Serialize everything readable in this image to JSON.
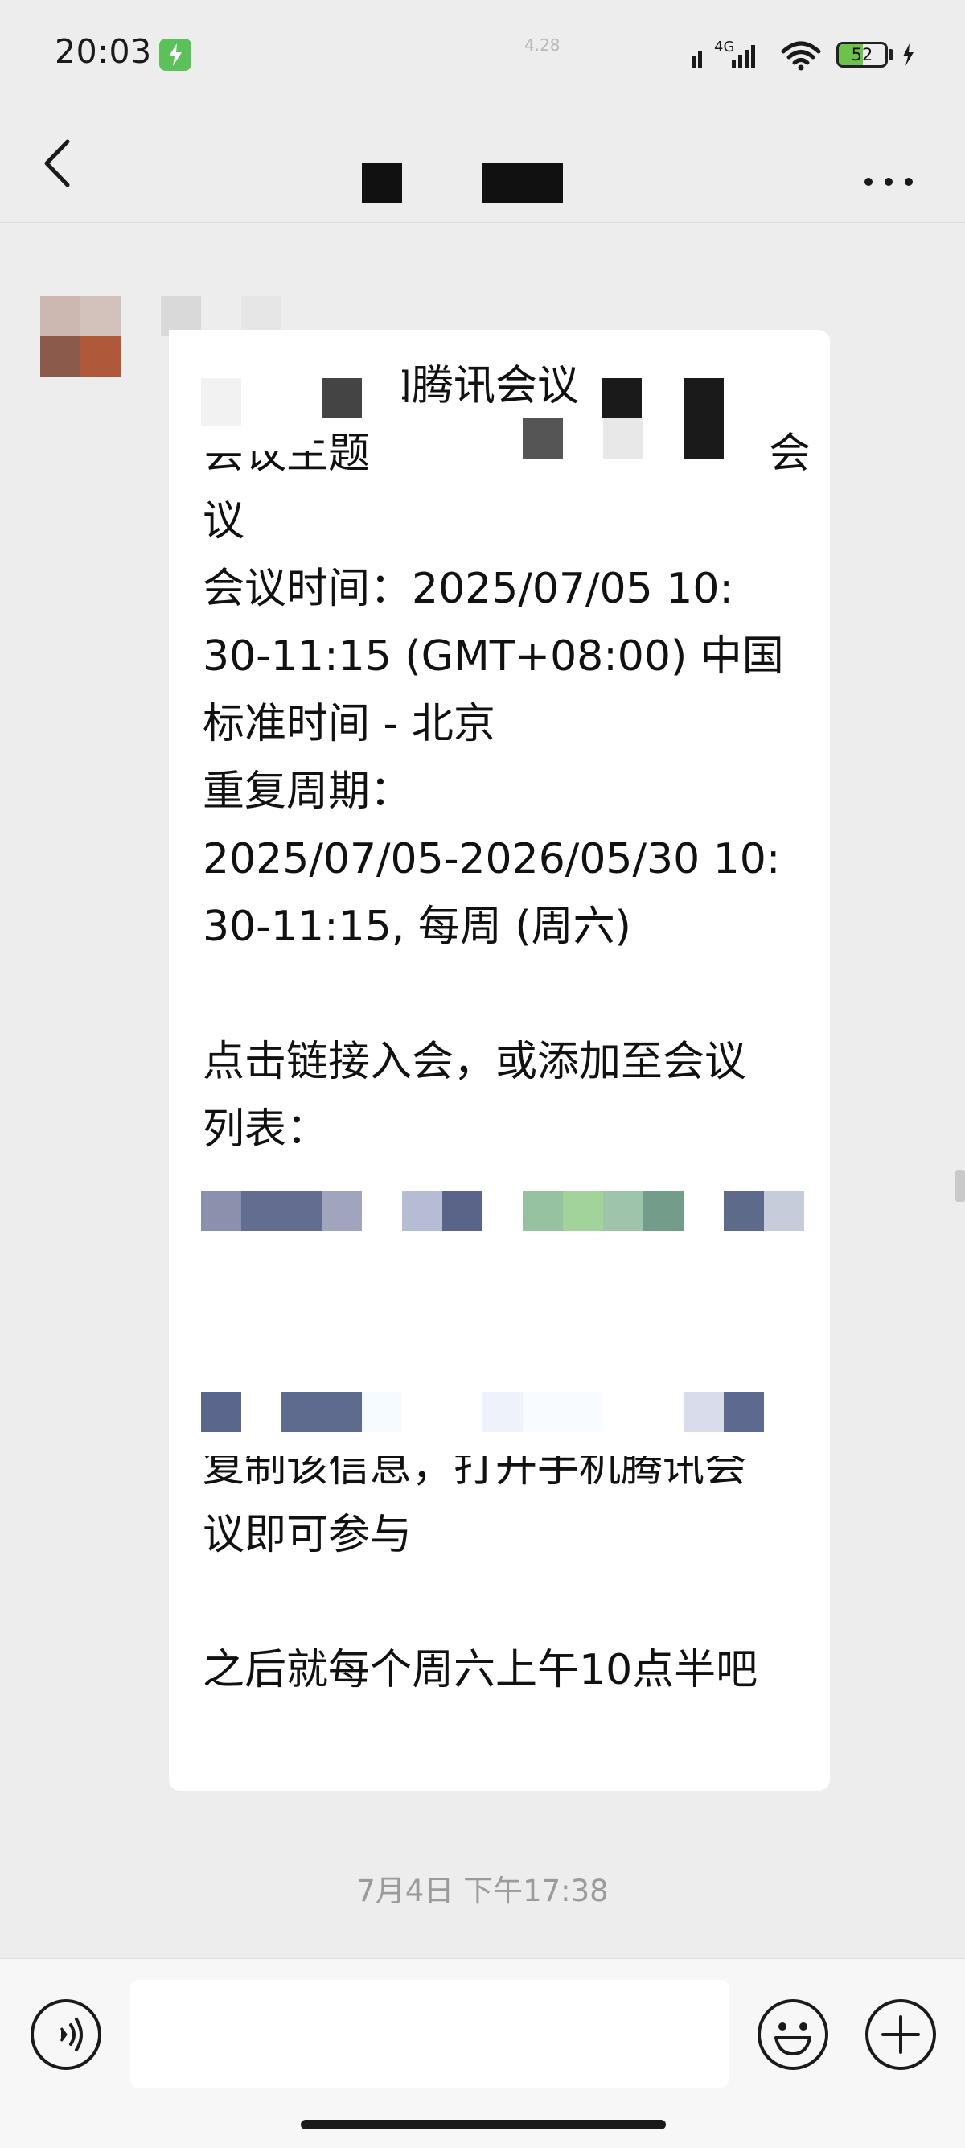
{
  "status_bar": {
    "time": "20:03",
    "net_speed": "4.28",
    "network": "4G",
    "battery_level": "52",
    "battery_fraction": 0.52
  },
  "nav": {
    "back_icon": "chevron-left-icon",
    "more_icon": "more-dots-icon"
  },
  "message": {
    "line_1": "邀请您参加腾讯会议",
    "line_2": "会议主题",
    "line_2_tail": "会",
    "line_3": "议",
    "line_4": "会议时间：2025/07/05 10:",
    "line_5": "30-11:15 (GMT+08:00) 中国",
    "line_6": "标准时间 - 北京",
    "line_7": "重复周期：",
    "line_8": "2025/07/05-2026/05/30 10:",
    "line_9": "30-11:15, 每周 (周六)",
    "line_10": "点击链接入会，或添加至会议",
    "line_11": "列表：",
    "line_12": "复制该信息，打开手机腾讯会",
    "line_13": "议即可参与",
    "line_14": "之后就每个周六上午10点半吧"
  },
  "timestamp": "7月4日 下午17:38",
  "input_bar": {
    "voice_icon": "voice-icon",
    "emoji_icon": "emoji-icon",
    "plus_icon": "plus-icon",
    "input_value": ""
  },
  "colors": {
    "background": "#ededed",
    "bubble": "#ffffff",
    "timestamp_text": "#9b9b9b",
    "battery_fill": "#6cc24a",
    "charge_badge": "#5cc15a"
  }
}
